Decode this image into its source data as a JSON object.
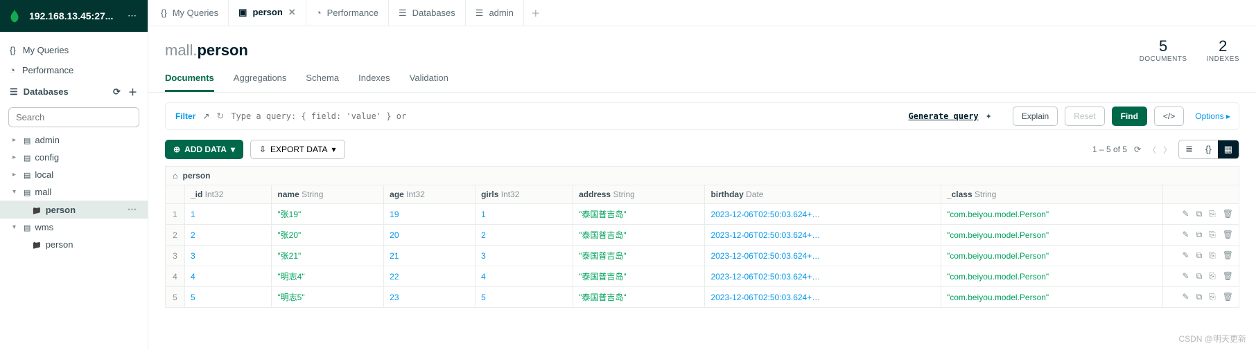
{
  "host": "192.168.13.45:27...",
  "side": {
    "my_queries": "My Queries",
    "performance": "Performance",
    "databases": "Databases",
    "search_placeholder": "Search"
  },
  "tree": [
    {
      "name": "admin",
      "expanded": false,
      "children": []
    },
    {
      "name": "config",
      "expanded": false,
      "children": []
    },
    {
      "name": "local",
      "expanded": false,
      "children": []
    },
    {
      "name": "mall",
      "expanded": true,
      "children": [
        {
          "name": "person",
          "active": true
        }
      ]
    },
    {
      "name": "wms",
      "expanded": true,
      "children": [
        {
          "name": "person",
          "active": false
        }
      ]
    }
  ],
  "tabs": [
    {
      "icon": "braces",
      "label": "My Queries",
      "close": false
    },
    {
      "icon": "folder",
      "label": "person",
      "close": true,
      "active": true
    },
    {
      "icon": "tach",
      "label": "Performance",
      "close": false
    },
    {
      "icon": "db",
      "label": "Databases",
      "close": false
    },
    {
      "icon": "db",
      "label": "admin",
      "close": false
    }
  ],
  "breadcrumb": {
    "db": "mall",
    "coll": "person"
  },
  "stats": {
    "documents_n": "5",
    "documents_l": "DOCUMENTS",
    "indexes_n": "2",
    "indexes_l": "INDEXES"
  },
  "subtabs": [
    "Documents",
    "Aggregations",
    "Schema",
    "Indexes",
    "Validation"
  ],
  "filter": {
    "label": "Filter",
    "placeholder": "Type a query: { field: 'value' } or",
    "generate": "Generate query",
    "explain": "Explain",
    "reset": "Reset",
    "find": "Find",
    "options": "Options"
  },
  "toolbar": {
    "add": "ADD DATA",
    "export": "EXPORT DATA",
    "range": "1 – 5 of 5"
  },
  "table": {
    "caption": "person",
    "columns": [
      {
        "name": "_id",
        "type": "Int32"
      },
      {
        "name": "name",
        "type": "String"
      },
      {
        "name": "age",
        "type": "Int32"
      },
      {
        "name": "girls",
        "type": "Int32"
      },
      {
        "name": "address",
        "type": "String"
      },
      {
        "name": "birthday",
        "type": "Date"
      },
      {
        "name": "_class",
        "type": "String"
      }
    ],
    "rows": [
      {
        "n": "1",
        "_id": "1",
        "name": "\"张19\"",
        "age": "19",
        "girls": "1",
        "address": "\"泰国普吉岛\"",
        "birthday": "2023-12-06T02:50:03.624+…",
        "_class": "\"com.beiyou.model.Person\""
      },
      {
        "n": "2",
        "_id": "2",
        "name": "\"张20\"",
        "age": "20",
        "girls": "2",
        "address": "\"泰国普吉岛\"",
        "birthday": "2023-12-06T02:50:03.624+…",
        "_class": "\"com.beiyou.model.Person\""
      },
      {
        "n": "3",
        "_id": "3",
        "name": "\"张21\"",
        "age": "21",
        "girls": "3",
        "address": "\"泰国普吉岛\"",
        "birthday": "2023-12-06T02:50:03.624+…",
        "_class": "\"com.beiyou.model.Person\""
      },
      {
        "n": "4",
        "_id": "4",
        "name": "\"明志4\"",
        "age": "22",
        "girls": "4",
        "address": "\"泰国普吉岛\"",
        "birthday": "2023-12-06T02:50:03.624+…",
        "_class": "\"com.beiyou.model.Person\""
      },
      {
        "n": "5",
        "_id": "5",
        "name": "\"明志5\"",
        "age": "23",
        "girls": "5",
        "address": "\"泰国普吉岛\"",
        "birthday": "2023-12-06T02:50:03.624+…",
        "_class": "\"com.beiyou.model.Person\""
      }
    ]
  },
  "watermark": "CSDN @明天更新"
}
